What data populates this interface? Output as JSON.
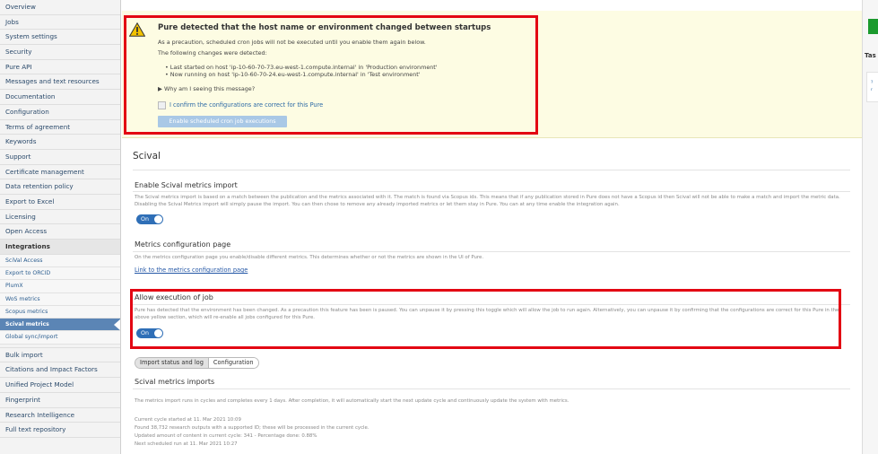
{
  "sidebar": {
    "top_items": [
      "Overview",
      "Jobs",
      "System settings",
      "Security",
      "Pure API",
      "Messages and text resources",
      "Documentation",
      "Configuration",
      "Terms of agreement",
      "Keywords",
      "Support",
      "Certificate management",
      "Data retention policy",
      "Export to Excel",
      "Licensing",
      "Open Access"
    ],
    "section_label": "Integrations",
    "sub_items": [
      "SciVal Access",
      "Export to ORCID",
      "PlumX",
      "WoS metrics",
      "Scopus metrics",
      "Scival metrics",
      "Global sync/import"
    ],
    "active_sub_item": "Scival metrics",
    "bottom_items": [
      "Bulk import",
      "Citations and Impact Factors",
      "Unified Project Model",
      "Fingerprint",
      "Research Intelligence",
      "Full text repository"
    ]
  },
  "warning": {
    "title": "Pure detected that the host name or environment changed between startups",
    "line1": "As a precaution, scheduled cron jobs will not be executed until you enable them again below.",
    "line2": "The following changes were detected:",
    "change1": "• Last started on host 'ip-10-60-70-73.eu-west-1.compute.internal' in 'Production environment'",
    "change2": "• Now running on host 'ip-10-60-70-24.eu-west-1.compute.internal' in 'Test environment'",
    "why": "▶ Why am I seeing this message?",
    "confirm_label": "I confirm the configurations are correct for this Pure",
    "enable_button": "Enable scheduled cron job executions"
  },
  "page": {
    "title": "Scival"
  },
  "enable_section": {
    "heading": "Enable Scival metrics import",
    "description": "The Scival metrics import is based on a match between the publication and the metrics associated with it. The match is found via Scopus ids. This means that if any publication stored in Pure does not have a Scopus id then Scival will not be able to make a match and import the metric data. Disabling the Scival Metrics import will simply pause the import. You can then chose to remove any already imported metrics or let them stay in Pure. You can at any time enable the integration again.",
    "toggle_label": "On"
  },
  "metrics_config": {
    "heading": "Metrics configuration page",
    "description": "On the metrics configuration page you enable/disable different metrics. This determines whether or not the metrics are shown in the UI of Pure.",
    "link": "Link to the metrics configuration page"
  },
  "allow_job": {
    "heading": "Allow execution of job",
    "description": "Pure has detected that the environment has been changed. As a precaution this feature has been is paused. You can unpause it by pressing this toggle which will allow the job to run again. Alternatively, you can unpause it by confirming that the configurations are correct for this Pure in the above yellow section, which will re-enable all jobs configured for this Pure.",
    "toggle_label": "On"
  },
  "tabs": [
    "Import status and log",
    "Configuration"
  ],
  "imports": {
    "heading": "Scival metrics imports",
    "description": "The metrics import runs in cycles and completes every 1 days. After completion, it will automatically start the next update cycle and continuously update the system with metrics.",
    "log": [
      "Current cycle started at 11. Mar 2021 10:09",
      "Found 38,732 research outputs with a supported ID; these will be processed in the current cycle.",
      "Updated amount of content in current cycle: 341 - Percentage done: 0.88%",
      "Next scheduled run at 11. Mar 2021 10:27"
    ]
  },
  "right_panel": {
    "heading_fragment": "Tas",
    "card_chars": [
      "?",
      "r"
    ]
  },
  "colors": {
    "warning_bg": "#fdfce3",
    "annotation_red": "#e30613",
    "toggle_blue": "#2f6fb7",
    "active_nav": "#5b85b5",
    "green_block": "#1b9a2e"
  }
}
